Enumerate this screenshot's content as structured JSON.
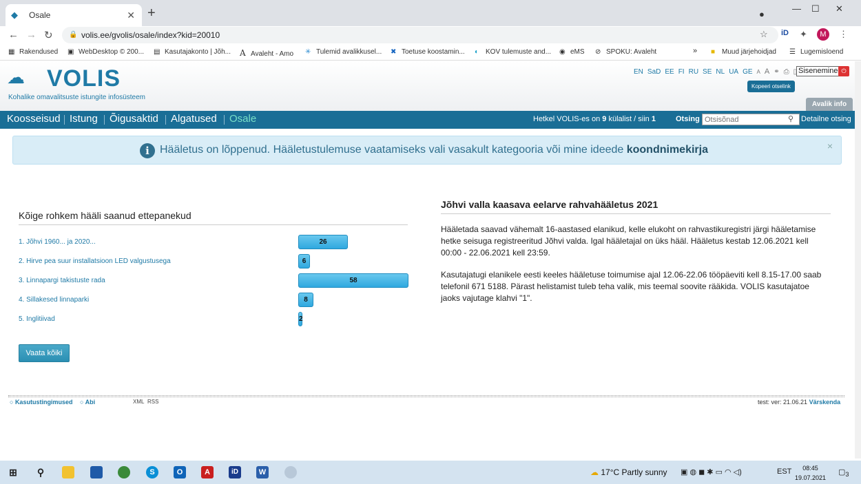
{
  "browser": {
    "tab_title": "Osale",
    "url": "volis.ee/gvolis/osale/index?kid=20010",
    "profile_initial": "M",
    "bookmarks": [
      {
        "label": "Rakendused",
        "icon": "apps-grid-icon"
      },
      {
        "label": "WebDesktop © 200...",
        "icon": "webdesktop-icon"
      },
      {
        "label": "Kasutajakonto | Jõh...",
        "icon": "account-icon"
      },
      {
        "label": "Avaleht - Amo",
        "icon": "letter-a-icon"
      },
      {
        "label": "Tulemid avalikkusel...",
        "icon": "network-icon"
      },
      {
        "label": "Toetuse koostamin...",
        "icon": "cross-icon"
      },
      {
        "label": "KOV tulemuste and...",
        "icon": "edge-icon"
      },
      {
        "label": "eMS",
        "icon": "globe-icon"
      },
      {
        "label": "SPOKU: Avaleht",
        "icon": "spoku-icon"
      }
    ],
    "bookmarks_overflow": "»",
    "other_bookmarks": "Muud järjehoidjad",
    "reading_list": "Lugemisloend"
  },
  "header": {
    "logo_text": "VOLIS",
    "logo_subtitle": "Kohalike omavalitsuste istungite infosüsteem",
    "languages": [
      "EN",
      "SaD",
      "EE",
      "FI",
      "RU",
      "SE",
      "NL",
      "UA",
      "GE"
    ],
    "font_small": "A",
    "font_large": "A",
    "login_label": "Sisenemine",
    "copy_link_tooltip": "Kopeeri otselink",
    "public_info_tab": "Avalik info"
  },
  "nav": {
    "items": [
      "Koosseisud",
      "Istung",
      "Õigusaktid",
      "Algatused",
      "Osale"
    ],
    "visitors_prefix": "Hetkel VOLIS-es on",
    "visitors_count": "9",
    "visitors_middle": "külalist / siin",
    "visitors_here": "1",
    "search_label": "Otsing",
    "search_placeholder": "Otsisõnad",
    "detailed_search": "Detailne otsing"
  },
  "alert": {
    "text": "Hääletus on lõppenud. Hääletustulemuse vaatamiseks vali vasakult kategooria või mine ideede",
    "link": "koondnimekirja",
    "close": "×"
  },
  "left": {
    "title": "Kõige rohkem hääli saanud ettepanekud",
    "proposals": [
      {
        "label": "1. Jõhvi 1960... ja 2020...",
        "votes": 26
      },
      {
        "label": "2. Hirve pea suur installatsioon LED valgustusega",
        "votes": 6
      },
      {
        "label": "3. Linnapargi takistuste rada",
        "votes": 58
      },
      {
        "label": "4. Sillakesed linnaparki",
        "votes": 8
      },
      {
        "label": "5. Inglitiivad",
        "votes": 2
      }
    ],
    "max_votes": 58,
    "view_all_button": "Vaata kõiki"
  },
  "right": {
    "title": "Jõhvi valla kaasava eelarve rahvahääletus 2021",
    "paragraph1": "Hääletada saavad vähemalt 16-aastased elanikud, kelle elukoht on rahvastikuregistri järgi hääletamise hetke seisuga registreeritud Jõhvi valda.  Igal hääletajal on üks hääl. Hääletus kestab 12.06.2021 kell 00:00 - 22.06.2021 kell 23:59.",
    "paragraph2": "Kasutajatugi elanikele eesti keeles hääletuse toimumise ajal 12.06-22.06 tööpäeviti kell 8.15-17.00 saab telefonil 671 5188. Pärast helistamist tuleb teha valik, mis teemal soovite rääkida. VOLIS kasutajatoe jaoks vajutage klahvi \"1\"."
  },
  "footer": {
    "terms": "Kasutustingimused",
    "help": "Abi",
    "xml": "XML",
    "rss": "RSS",
    "version": "test: ver: 21.06.21",
    "refresh": "Värskenda"
  },
  "taskbar": {
    "temperature": "17°C",
    "weather": "Partly sunny",
    "language": "EST",
    "time": "08:45",
    "date": "19.07.2021",
    "notifications": "3"
  },
  "colors": {
    "brand": "#1f7aa6",
    "nav_bg": "#1a6e96",
    "active_nav": "#79e0c8",
    "alert_bg": "#d9edf7",
    "bar": "#3db1e3"
  }
}
